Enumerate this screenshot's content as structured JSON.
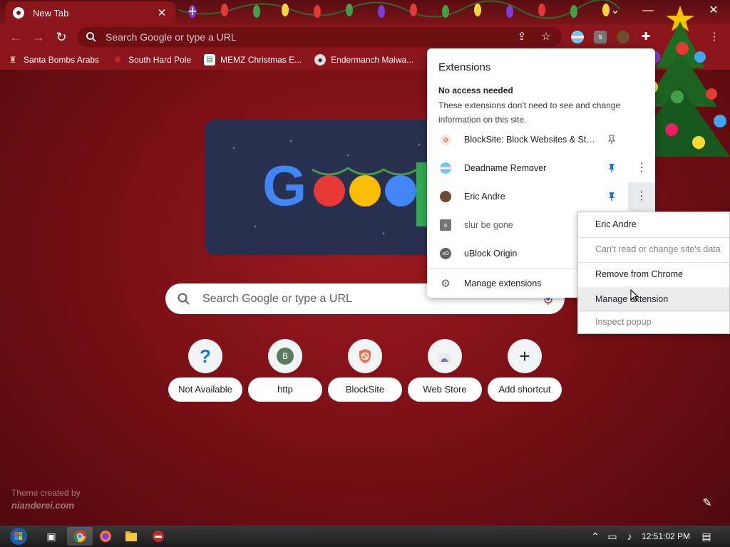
{
  "window": {
    "tab_title": "New Tab",
    "tab_close": "✕",
    "new_tab": "+",
    "minimize": "—",
    "maximize": "⌄",
    "close": "✕"
  },
  "toolbar": {
    "omnibox_placeholder": "Search Google or type a URL"
  },
  "bookmarks": [
    {
      "label": "Santa Bombs Arabs",
      "icon": "figure-icon"
    },
    {
      "label": "South Hard Pole",
      "icon": "snowflake-icon"
    },
    {
      "label": "MEMZ Christmas E...",
      "icon": "doc-icon"
    },
    {
      "label": "Endermanch Malwa...",
      "icon": "raccoon-icon"
    }
  ],
  "ntp": {
    "search_placeholder": "Search Google or type a URL",
    "doodle_text": "Google",
    "shortcuts": [
      {
        "label": "Not Available",
        "glyph": "?",
        "icon": "question-icon"
      },
      {
        "label": "http",
        "glyph": "B",
        "icon": "letter-b-icon"
      },
      {
        "label": "BlockSite",
        "glyph": "",
        "icon": "blocksite-icon"
      },
      {
        "label": "Web Store",
        "glyph": "",
        "icon": "webstore-icon"
      },
      {
        "label": "Add shortcut",
        "glyph": "+",
        "icon": "plus-icon"
      }
    ],
    "theme_credit_line1": "Theme created by",
    "theme_credit_line2": "nianderei.com"
  },
  "extensions_popup": {
    "title": "Extensions",
    "section_heading": "No access needed",
    "section_desc": "These extensions don't need to see and change information on this site.",
    "items": [
      {
        "name": "BlockSite: Block Websites & Sta...",
        "pinned": false,
        "muted": false,
        "color": "#d93025",
        "glyph": "⊘"
      },
      {
        "name": "Deadname Remover",
        "pinned": true,
        "muted": false,
        "color": "#5bcefa",
        "glyph": ""
      },
      {
        "name": "Eric Andre",
        "pinned": true,
        "muted": false,
        "color": "#6d4c2f",
        "glyph": ""
      },
      {
        "name": "slur be gone",
        "pinned": false,
        "muted": true,
        "color": "#757575",
        "glyph": "s"
      },
      {
        "name": "uBlock Origin",
        "pinned": false,
        "muted": false,
        "color": "#5f6368",
        "glyph": "uO"
      }
    ],
    "manage_label": "Manage extensions"
  },
  "context_menu": {
    "items": [
      {
        "label": "Eric Andre",
        "disabled": false
      },
      {
        "label": "Can't read or change site's data",
        "disabled": true
      },
      {
        "label": "Remove from Chrome",
        "disabled": false
      },
      {
        "label": "Manage extension",
        "disabled": false
      },
      {
        "label": "Inspect popup",
        "disabled": true
      }
    ]
  },
  "taskbar": {
    "clock": "12:51:02 PM"
  },
  "colors": {
    "frame": "#8a161c",
    "background": "#7a1016",
    "pin_blue": "#1a73e8"
  }
}
